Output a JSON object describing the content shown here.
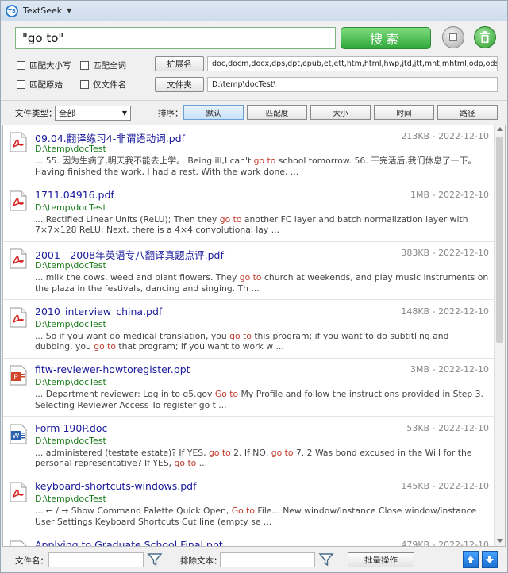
{
  "app": {
    "title": "TextSeek",
    "icon_label": "TS"
  },
  "search": {
    "query": "\"go to\"",
    "search_button": "搜索"
  },
  "options": {
    "match_case": "匹配大小写",
    "match_whole_word": "匹配全词",
    "match_original": "匹配原始",
    "file_name_only": "仅文件名"
  },
  "extensions": {
    "button": "扩展名",
    "value": "doc,docm,docx,dps,dpt,epub,et,ett,htm,html,hwp,jtd,jtt,mht,mhtml,odp,ods,odt,ofd,"
  },
  "folder": {
    "button": "文件夹",
    "value": "D:\\temp\\docTest\\"
  },
  "filter": {
    "file_type_label": "文件类型：",
    "file_type_value": "全部",
    "sort_label": "排序：",
    "sort_buttons": [
      "默认",
      "匹配度",
      "大小",
      "时间",
      "路径"
    ]
  },
  "results": [
    {
      "icon": "pdf-icon",
      "name": "09.04.翻译练习4-非谓语动词.pdf",
      "size": "213KB",
      "date": "2022-12-10",
      "path": "D:\\temp\\docTest",
      "snippet": [
        {
          "t": "... 55. 因为生病了,明天我不能去上学。 Being ill,I can't "
        },
        {
          "t": "go to",
          "hl": true
        },
        {
          "t": " school tomorrow. 56. 干完活后,我们休息了一下。 Having finished the work, I had a rest. With the work done, ..."
        }
      ]
    },
    {
      "icon": "pdf-icon",
      "name": "1711.04916.pdf",
      "size": "1MB",
      "date": "2022-12-10",
      "path": "D:\\temp\\docTest",
      "snippet": [
        {
          "t": "... Rectified Linear Units (ReLU); Then they "
        },
        {
          "t": "go to",
          "hl": true
        },
        {
          "t": " another FC layer and batch normalization layer with 7×7×128 ReLU; Next, there is a 4×4 convolutional lay ..."
        }
      ]
    },
    {
      "icon": "pdf-icon",
      "name": "2001—2008年英语专八翻译真题点评.pdf",
      "size": "383KB",
      "date": "2022-12-10",
      "path": "D:\\temp\\docTest",
      "snippet": [
        {
          "t": "... milk the cows, weed and plant flowers. They "
        },
        {
          "t": "go to",
          "hl": true
        },
        {
          "t": " church at weekends, and play music instruments on the plaza in the festivals, dancing and singing. Th ..."
        }
      ]
    },
    {
      "icon": "pdf-icon",
      "name": "2010_interview_china.pdf",
      "size": "148KB",
      "date": "2022-12-10",
      "path": "D:\\temp\\docTest",
      "snippet": [
        {
          "t": "... So if you want do medical translation, you "
        },
        {
          "t": "go to",
          "hl": true
        },
        {
          "t": " this program; if you want to do subtitling and dubbing, you "
        },
        {
          "t": "go to",
          "hl": true
        },
        {
          "t": " that program; if you want to work w ..."
        }
      ]
    },
    {
      "icon": "ppt-icon",
      "name": "fitw-reviewer-howtoregister.ppt",
      "size": "3MB",
      "date": "2022-12-10",
      "path": "D:\\temp\\docTest",
      "snippet": [
        {
          "t": "... Department reviewer: Log in to g5.gov "
        },
        {
          "t": "Go to",
          "hl": true
        },
        {
          "t": " My Profile and follow the instructions provided in Step 3. Selecting Reviewer Access To register go t ..."
        }
      ]
    },
    {
      "icon": "word-icon",
      "name": "Form 190P.doc",
      "size": "53KB",
      "date": "2022-12-10",
      "path": "D:\\temp\\docTest",
      "snippet": [
        {
          "t": "... administered (testate estate)? If YES, "
        },
        {
          "t": "go to",
          "hl": true
        },
        {
          "t": " 2. If NO, "
        },
        {
          "t": "go to",
          "hl": true
        },
        {
          "t": " 7. 2 Was bond excused in the Will for the personal representative? If YES, "
        },
        {
          "t": "go to",
          "hl": true
        },
        {
          "t": " ..."
        }
      ]
    },
    {
      "icon": "pdf-icon",
      "name": "keyboard-shortcuts-windows.pdf",
      "size": "145KB",
      "date": "2022-12-10",
      "path": "D:\\temp\\docTest",
      "snippet": [
        {
          "t": "... ← / → Show Command Palette Quick Open, "
        },
        {
          "t": "Go to",
          "hl": true
        },
        {
          "t": " File... New window/instance Close window/instance User Settings Keyboard Shortcuts Cut line (empty se ..."
        }
      ]
    },
    {
      "icon": "ppt-icon",
      "name": "Applying to Graduate School Final.ppt",
      "size": "479KB",
      "date": "2022-12-10",
      "path": "",
      "snippet": []
    }
  ],
  "bottom": {
    "file_name_label": "文件名：",
    "exclude_text_label": "排除文本：",
    "batch_button": "批量操作"
  },
  "colors": {
    "highlight": "#c0392b",
    "link": "#1a1a9c",
    "path": "#1b7a1b",
    "accent": "#2fa83a"
  }
}
